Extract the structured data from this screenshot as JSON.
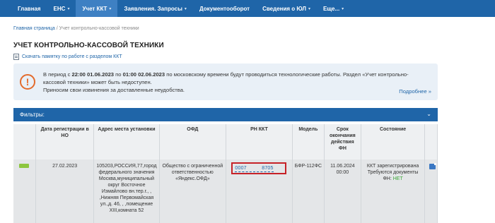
{
  "nav": {
    "items": [
      {
        "label": "Главная",
        "active": false,
        "caret": false
      },
      {
        "label": "ЕНС",
        "active": false,
        "caret": true
      },
      {
        "label": "Учет ККТ",
        "active": true,
        "caret": true
      },
      {
        "label": "Заявления. Запросы",
        "active": false,
        "caret": true
      },
      {
        "label": "Документооборот",
        "active": false,
        "caret": false
      },
      {
        "label": "Сведения о ЮЛ",
        "active": false,
        "caret": true
      },
      {
        "label": "Еще...",
        "active": false,
        "caret": true
      }
    ]
  },
  "breadcrumb": {
    "home": "Главная страница",
    "separator": "/",
    "current": "Учет контрольно-кассовой техники"
  },
  "page": {
    "title": "УЧЕТ КОНТРОЛЬНО-КАССОВОЙ ТЕХНИКИ",
    "memo_link": "Скачать памятку по работе с разделом ККТ"
  },
  "notice": {
    "icon": "exclamation-icon",
    "line1_prefix": "В период с ",
    "from": "22:00 01.06.2023",
    "mid": " по ",
    "to": "01:00 02.06.2023",
    "line1_suffix": " по московскому времени будут проводиться технологические работы. Раздел «Учет контрольно-кассовой техники» может быть недоступен.",
    "line2": "Приносим свои извинения за доставленные неудобства.",
    "more": "Подробнее »"
  },
  "filters": {
    "label": "Фильтры:",
    "chevron": "chevron-down-icon"
  },
  "table": {
    "columns": [
      "",
      "Дата регистрации в НО",
      "Адрес места установки",
      "ОФД",
      "РН ККТ",
      "Модель",
      "Срок окончания действия ФН",
      "Состояние",
      ""
    ],
    "rows": [
      {
        "status_color": "#8dc63f",
        "reg_date": "27.02.2023",
        "address": "105203,РОССИЯ,77,город федерального значения Москва,муниципальный округ Восточное Измайлово вн.тер.г., , ,Нижняя Первомайская ул.,д. 46, , ,помещение XIII,комната 52",
        "ofd": "Общество с ограниченной ответственностью «Яндекс.ОФД»",
        "rn_part1": "0007",
        "rn_part2": "8705",
        "model": "БФР-112ФС",
        "fn_end": "11.06.2024 00:00",
        "state_line1": "ККТ зарегистрирована",
        "state_line2": "Требуются документы",
        "state_fn_prefix": "ФН: ",
        "state_fn_value": "НЕТ"
      }
    ]
  }
}
